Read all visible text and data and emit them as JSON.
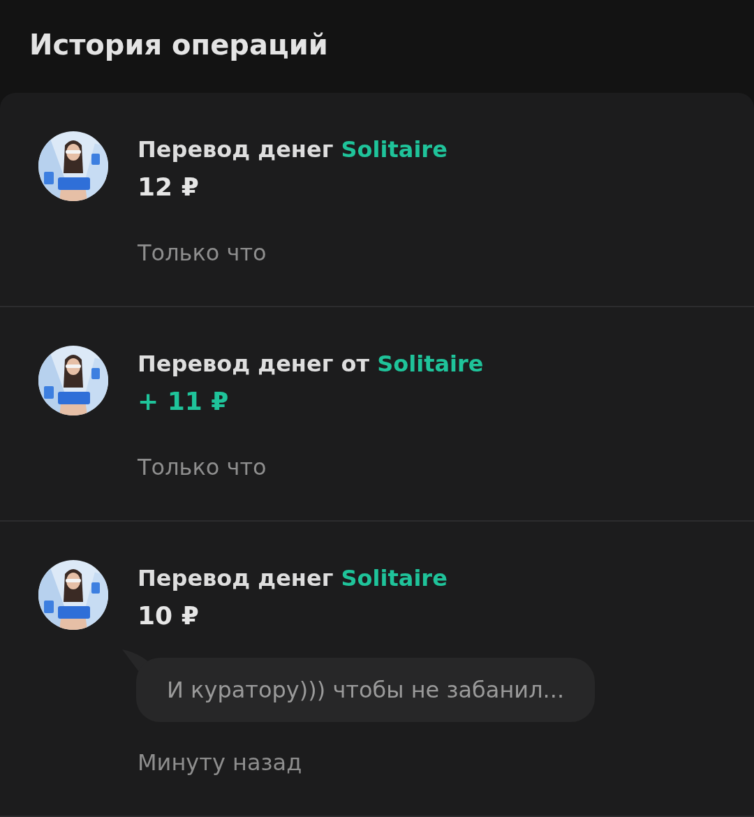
{
  "title": "История операций",
  "operations": [
    {
      "label": "Перевод денег",
      "counterparty": "Solitaire",
      "amount": "12 ₽",
      "kind": "outgoing",
      "time": "Только что"
    },
    {
      "label": "Перевод денег от",
      "counterparty": "Solitaire",
      "amount": "+ 11 ₽",
      "kind": "incoming",
      "time": "Только что"
    },
    {
      "label": "Перевод денег",
      "counterparty": "Solitaire",
      "amount": "10 ₽",
      "kind": "outgoing",
      "comment": "И куратору))) чтобы не забанил...",
      "time": "Минуту назад"
    }
  ]
}
